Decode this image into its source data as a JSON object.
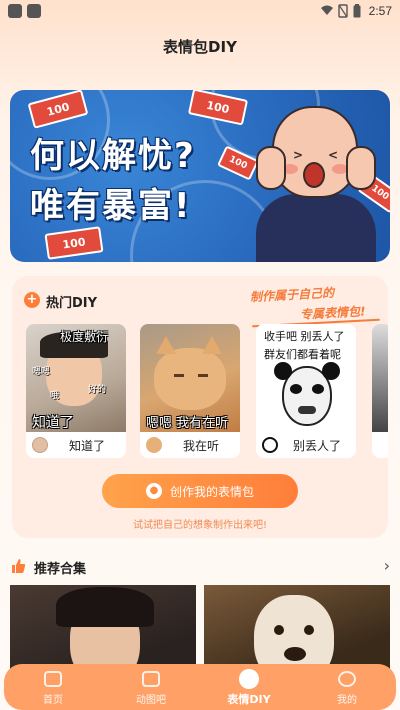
{
  "status_bar": {
    "time": "2:57"
  },
  "header": {
    "title": "表情包DIY"
  },
  "banner": {
    "line1": "何以解忧?",
    "line2": "唯有暴富!",
    "bill_text": "100"
  },
  "hot_diy": {
    "title": "热门DIY",
    "slogan_line1": "制作属于自己的",
    "slogan_line2": "专属表情包!",
    "memes": [
      {
        "caption_top": "极度敷衍",
        "caption_big": "知道了",
        "name": "知道了",
        "small_text1": "嗯嗯",
        "small_text2": "哦",
        "small_text3": "好的"
      },
      {
        "caption_big": "嗯嗯 我有在听",
        "name": "我在听"
      },
      {
        "caption_top_line1": "收手吧 别丢人了",
        "caption_top_line2": "群友们都看着呢",
        "name": "别丢人了"
      }
    ],
    "create_button": "创作我的表情包",
    "hint": "试试把自己的想象制作出来吧!"
  },
  "recommend": {
    "title": "推荐合集",
    "more_icon": "chevron-right-icon"
  },
  "tabs": [
    {
      "label": "首页",
      "icon": "home-icon",
      "active": false
    },
    {
      "label": "动图吧",
      "icon": "gif-icon",
      "active": false
    },
    {
      "label": "表情DIY",
      "icon": "smile-icon",
      "active": true
    },
    {
      "label": "我的",
      "icon": "profile-icon",
      "active": false
    }
  ],
  "colors": {
    "accent": "#ff7e3a",
    "tabbar": "#ffa066",
    "banner_blue": "#2a6cc0"
  }
}
